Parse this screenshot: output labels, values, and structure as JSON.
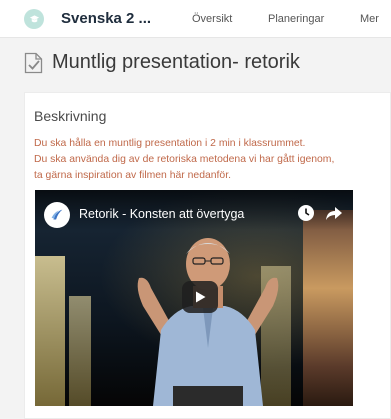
{
  "topbar": {
    "course_title": "Svenska 2 ...",
    "nav": [
      "Översikt",
      "Planeringar",
      "Mer"
    ]
  },
  "page": {
    "title": "Muntlig presentation- retorik"
  },
  "description": {
    "heading": "Beskrivning",
    "lines": [
      "Du ska hålla en muntlig presentation i 2 min i klassrummet.",
      "Du ska använda dig av de retoriska metodena vi har gått igenom,",
      "ta gärna inspiration av filmen här nedanför."
    ]
  },
  "video": {
    "title": "Retorik - Konsten att övertyga"
  },
  "colors": {
    "course_icon_bg": "#bfe3dc",
    "description_text": "#c0694a",
    "page_bg": "#f3f3f3"
  },
  "icons": {
    "course": "course-icon",
    "document": "document-check-icon",
    "watch_later": "clock-icon",
    "share": "share-icon",
    "play": "play-icon"
  }
}
